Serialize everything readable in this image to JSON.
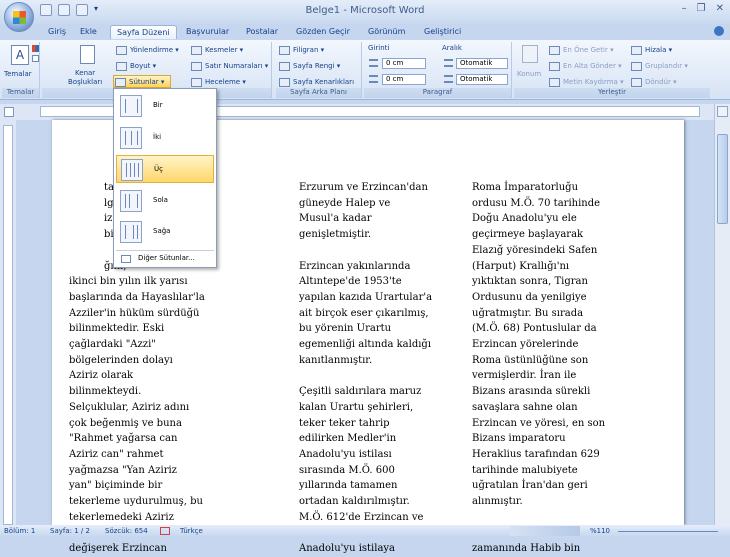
{
  "window": {
    "title": "Belge1 - Microsoft Word"
  },
  "tabs": [
    "Giriş",
    "Ekle",
    "Sayfa Düzeni",
    "Başvurular",
    "Postalar",
    "Gözden Geçir",
    "Görünüm",
    "Geliştirici"
  ],
  "ribbon": {
    "temalar": {
      "button": "Temalar",
      "label": "Temalar"
    },
    "sayfa_yapisi": {
      "kenar_boşluklari": "Kenar\nBoşlukları",
      "yonlendirme": "Yönlendirme",
      "boyut": "Boyut",
      "sutunlar": "Sütunlar",
      "kesmeler": "Kesmeler",
      "satir_numaralari": "Satır Numaraları",
      "heceleme": "Heceleme"
    },
    "arka_plan": {
      "filigran": "Filigran",
      "sayfa_rengi": "Sayfa Rengi",
      "sayfa_kenarliklari": "Sayfa Kenarlıkları",
      "label": "Sayfa Arka Planı"
    },
    "paragraf": {
      "girinti": "Girinti",
      "aralik": "Aralık",
      "sol_value": "0 cm",
      "sag_value": "0 cm",
      "once_value": "Otomatik",
      "sonra_value": "Otomatik",
      "label": "Paragraf"
    },
    "yerlestir": {
      "konum": "Konum",
      "en_one_getir": "En Öne Getir",
      "en_alta_gonder": "En Alta Gönder",
      "metin_kaydirma": "Metin Kaydırma",
      "hizala": "Hizala",
      "gruplandir": "Gruplandır",
      "dondur": "Döndür",
      "label": "Yerleştir"
    },
    "temalar_label": "Temalar"
  },
  "menu": {
    "items": [
      "Bir",
      "İki",
      "Üç",
      "Sola",
      "Sağa"
    ],
    "more": "Diğer Sütunlar..."
  },
  "document": {
    "col1": "           tarihi\n           lgiye\n           iz. Ne\n           bin\n\n           ğını,\nikinci bin yılın ilk yarısı\nbaşlarında da Hayaslılar'la\nAzziler'in hüküm sürdüğü\nbilinmektedir. Eski\nçağlardaki \"Azzi\"\nbölgelerinden dolayı\nAziriz olarak\nbilinmekteydi.\nSelçuklular, Aziriz adını\nçok beğenmiş ve buna\n\"Rahmet yağarsa can\nAziriz can\" rahmet\nyağmazsa \"Yan Aziriz\nyan\" biçiminde bir\ntekerleme uydurulmuş, bu\ntekerlemedeki Aziriz\nsözcüğü zamanla\ndeğişerek Erzincan",
    "col2": "Erzurum ve Erzincan'dan\ngüneyde Halep ve\nMusul'a kadar\ngenişletmiştir.\n\nErzincan yakınlarında\nAltıntepe'de 1953'te\nyapılan kazıda Urartular'a\nait birçok eser çıkarılmış,\nbu yörenin Urartu\negemenliği altında kaldığı\nkanıtlanmıştır.\n\nÇeşitli saldırılara maruz\nkalan Urartu şehirleri,\nteker teker tahrip\nedilirken Medler'in\nAnadolu'yu istilası\nsırasında M.Ö. 600\nyıllarında tamamen\nortadan kaldırılmıştır.\nM.Ö. 612'de Erzincan ve\nyöresi Urartular'ı yenerek\nAnadolu'yu istilaya",
    "col3": "Roma İmparatorluğu\nordusu M.Ö. 70 tarihinde\nDoğu Anadolu'yu ele\ngeçirmeye başlayarak\nElazığ yöresindeki Safen\n(Harput) Krallığı'nı\nyıktıktan sonra, Tigran\nOrdusunu da yenilgiye\nuğratmıştır. Bu sırada\n(M.Ö. 68) Pontuslular da\nErzincan yörelerinde\nRoma üstünlüğüne son\nvermişlerdir. İran ile\nBizans arasında sürekli\nsavaşlara sahne olan\nErzincan ve yöresi, en son\nBizans imparatoru\nHeraklius tarafından 629\ntarihinde malubiyete\nuğratılan İran'dan geri\nalınmıştır.\n\nHalife Osman (644-656)\nzamanında Habib bin"
  },
  "status": {
    "bolum": "Bölüm: 1",
    "sayfa": "Sayfa: 1 / 2",
    "sozcuk": "Sözcük: 654",
    "dil": "Türkçe",
    "zoom": "%110"
  }
}
